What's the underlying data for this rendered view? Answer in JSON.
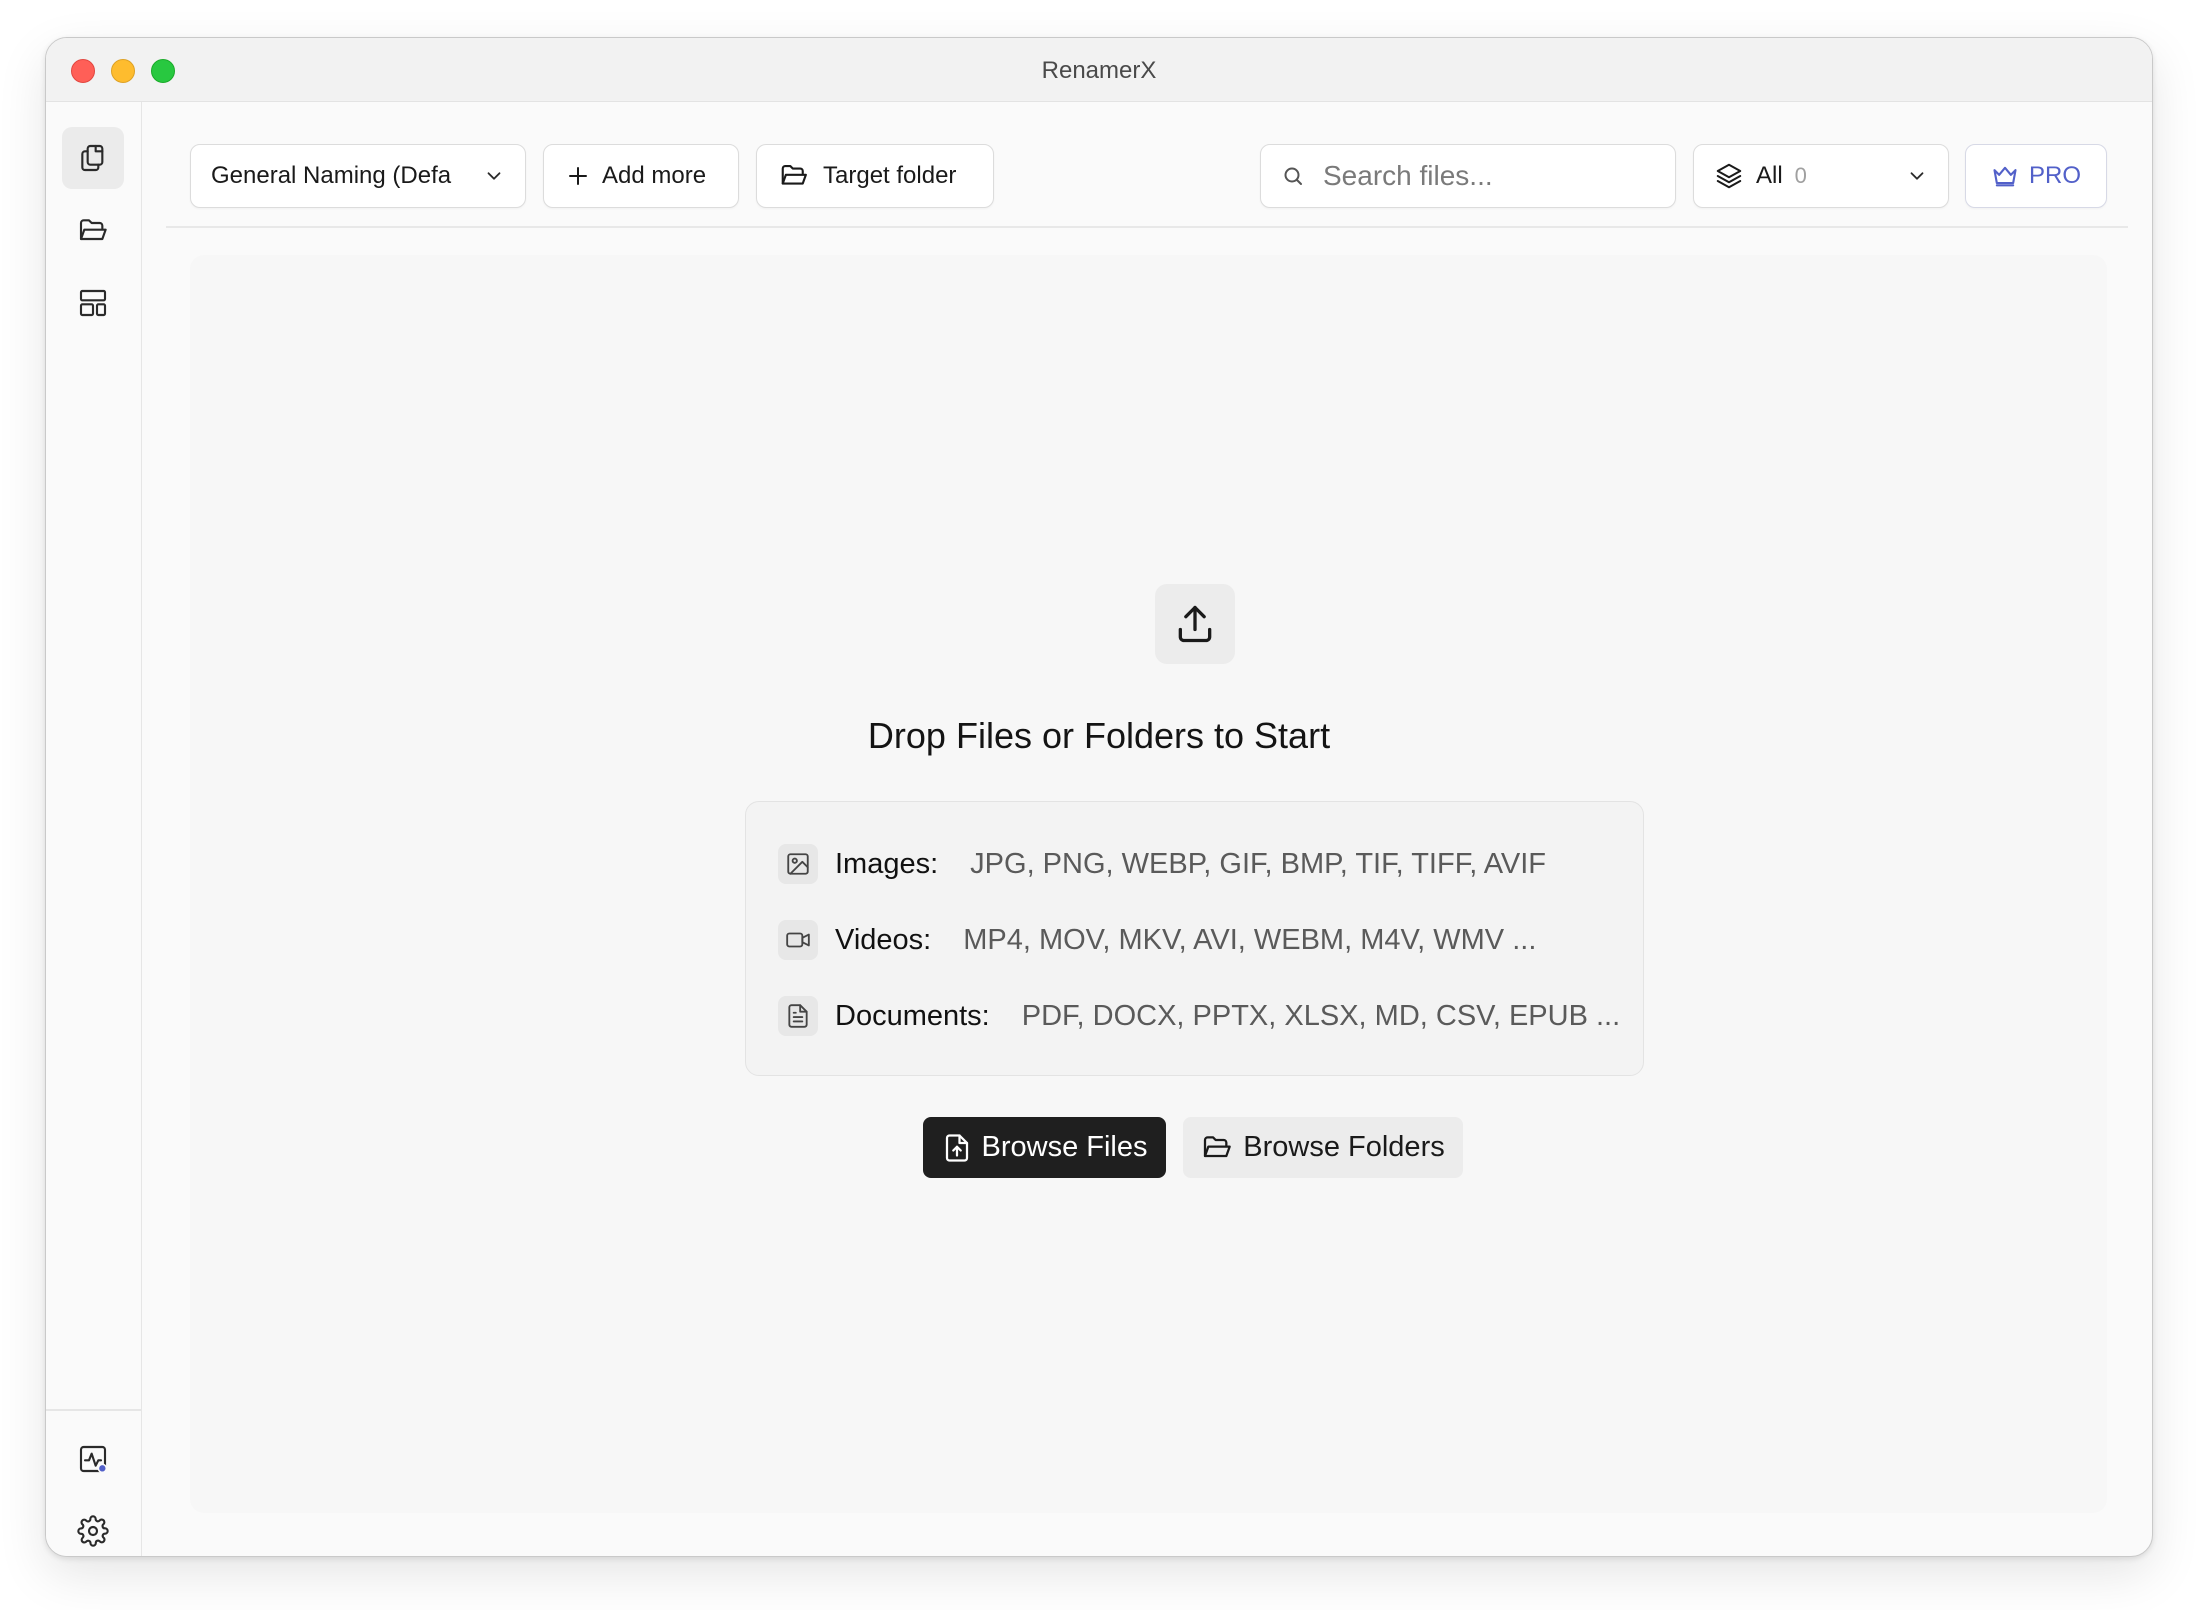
{
  "window": {
    "title": "RenamerX"
  },
  "sidebar": {
    "items": [
      {
        "name": "files",
        "icon": "files-icon",
        "active": true
      },
      {
        "name": "folders",
        "icon": "folder-open-icon",
        "active": false
      },
      {
        "name": "templates",
        "icon": "layout-icon",
        "active": false
      }
    ],
    "bottom": [
      {
        "name": "activity",
        "icon": "activity-icon"
      },
      {
        "name": "settings",
        "icon": "gear-icon"
      }
    ]
  },
  "toolbar": {
    "preset_label": "General Naming (Defa",
    "add_more_label": "Add more",
    "target_folder_label": "Target folder",
    "search_placeholder": "Search files...",
    "filter_label": "All",
    "filter_count": "0",
    "pro_label": "PRO"
  },
  "dropzone": {
    "title": "Drop Files or Folders to Start",
    "types": [
      {
        "label": "Images:",
        "values": "JPG, PNG, WEBP, GIF, BMP, TIF, TIFF, AVIF",
        "icon": "image-icon"
      },
      {
        "label": "Videos:",
        "values": "MP4, MOV, MKV, AVI, WEBM, M4V, WMV ...",
        "icon": "video-icon"
      },
      {
        "label": "Documents:",
        "values": "PDF, DOCX, PPTX, XLSX, MD, CSV, EPUB ...",
        "icon": "document-icon"
      }
    ],
    "browse_files_label": "Browse Files",
    "browse_folders_label": "Browse Folders"
  },
  "colors": {
    "accent_pro": "#5260c9",
    "primary_button": "#1f1f1f",
    "activity_dot": "#5260c9"
  }
}
